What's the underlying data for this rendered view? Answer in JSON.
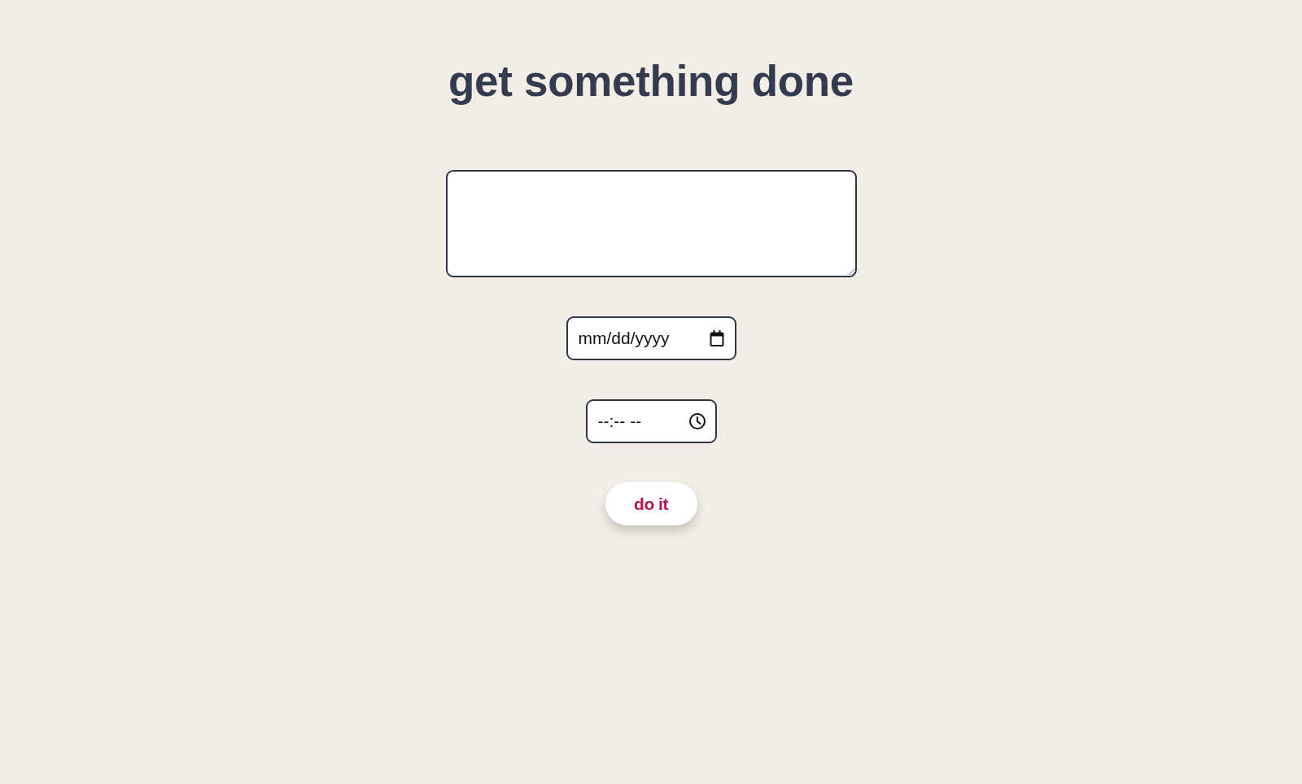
{
  "title": "get something done",
  "fields": [
    {
      "kind": "textarea"
    },
    {
      "kind": "date",
      "placeholder": "mm/dd/yyyy"
    },
    {
      "kind": "time",
      "placeholder": "--:-- --"
    }
  ],
  "button": {
    "label": "do it"
  }
}
